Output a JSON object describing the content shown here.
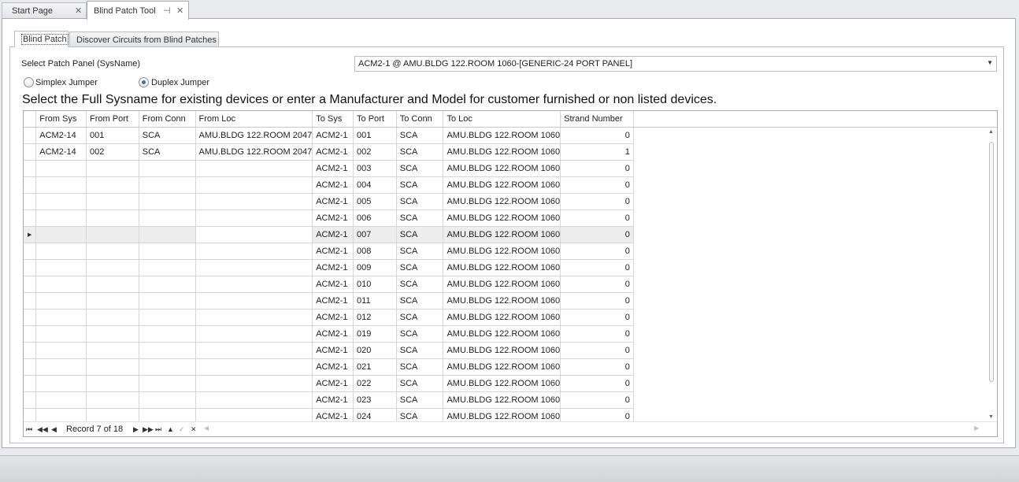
{
  "doc_tabs": [
    {
      "label": "Start Page",
      "close": "✕"
    },
    {
      "label": "Blind Patch Tool",
      "pin": "⊣",
      "close": "✕"
    }
  ],
  "inner_tabs": [
    "Blind Patch",
    "Discover Circuits from Blind Patches"
  ],
  "form": {
    "patch_panel_label": "Select Patch Panel (SysName)",
    "patch_panel_value": "ACM2-1 @ AMU.BLDG 122.ROOM 1060-[GENERIC-24 PORT PANEL]",
    "radio_simplex": "Simplex Jumper",
    "radio_duplex": "Duplex Jumper",
    "selected_jumper": "Duplex Jumper",
    "instruction": "Select the Full Sysname for existing devices or enter a Manufacturer and Model for customer furnished or non listed devices."
  },
  "grid": {
    "columns": [
      "From Sys",
      "From Port",
      "From Conn",
      "From Loc",
      "To Sys",
      "To Port",
      "To Conn",
      "To Loc",
      "Strand Number"
    ],
    "focused_row": 7,
    "rows": [
      [
        "ACM2-14",
        "001",
        "SCA",
        "AMU.BLDG 122.ROOM 2047",
        "ACM2-1",
        "001",
        "SCA",
        "AMU.BLDG 122.ROOM 1060",
        "0"
      ],
      [
        "ACM2-14",
        "002",
        "SCA",
        "AMU.BLDG 122.ROOM 2047",
        "ACM2-1",
        "002",
        "SCA",
        "AMU.BLDG 122.ROOM 1060",
        "1"
      ],
      [
        "",
        "",
        "",
        "",
        "ACM2-1",
        "003",
        "SCA",
        "AMU.BLDG 122.ROOM 1060",
        "0"
      ],
      [
        "",
        "",
        "",
        "",
        "ACM2-1",
        "004",
        "SCA",
        "AMU.BLDG 122.ROOM 1060",
        "0"
      ],
      [
        "",
        "",
        "",
        "",
        "ACM2-1",
        "005",
        "SCA",
        "AMU.BLDG 122.ROOM 1060",
        "0"
      ],
      [
        "",
        "",
        "",
        "",
        "ACM2-1",
        "006",
        "SCA",
        "AMU.BLDG 122.ROOM 1060",
        "0"
      ],
      [
        "",
        "",
        "",
        "",
        "ACM2-1",
        "007",
        "SCA",
        "AMU.BLDG 122.ROOM 1060",
        "0"
      ],
      [
        "",
        "",
        "",
        "",
        "ACM2-1",
        "008",
        "SCA",
        "AMU.BLDG 122.ROOM 1060",
        "0"
      ],
      [
        "",
        "",
        "",
        "",
        "ACM2-1",
        "009",
        "SCA",
        "AMU.BLDG 122.ROOM 1060",
        "0"
      ],
      [
        "",
        "",
        "",
        "",
        "ACM2-1",
        "010",
        "SCA",
        "AMU.BLDG 122.ROOM 1060",
        "0"
      ],
      [
        "",
        "",
        "",
        "",
        "ACM2-1",
        "011",
        "SCA",
        "AMU.BLDG 122.ROOM 1060",
        "0"
      ],
      [
        "",
        "",
        "",
        "",
        "ACM2-1",
        "012",
        "SCA",
        "AMU.BLDG 122.ROOM 1060",
        "0"
      ],
      [
        "",
        "",
        "",
        "",
        "ACM2-1",
        "019",
        "SCA",
        "AMU.BLDG 122.ROOM 1060",
        "0"
      ],
      [
        "",
        "",
        "",
        "",
        "ACM2-1",
        "020",
        "SCA",
        "AMU.BLDG 122.ROOM 1060",
        "0"
      ],
      [
        "",
        "",
        "",
        "",
        "ACM2-1",
        "021",
        "SCA",
        "AMU.BLDG 122.ROOM 1060",
        "0"
      ],
      [
        "",
        "",
        "",
        "",
        "ACM2-1",
        "022",
        "SCA",
        "AMU.BLDG 122.ROOM 1060",
        "0"
      ],
      [
        "",
        "",
        "",
        "",
        "ACM2-1",
        "023",
        "SCA",
        "AMU.BLDG 122.ROOM 1060",
        "0"
      ],
      [
        "",
        "",
        "",
        "",
        "ACM2-1",
        "024",
        "SCA",
        "AMU.BLDG 122.ROOM 1060",
        "0"
      ]
    ]
  },
  "navigator": {
    "record_text": "Record 7 of 18",
    "first": "⏮",
    "prev_page": "◀◀",
    "prev": "◀",
    "next": "▶",
    "next_page": "▶▶",
    "last": "⏭",
    "append": "▲",
    "end_edit": "✓",
    "cancel_edit": "✕"
  },
  "icons": {
    "row_indicator": "▶",
    "dropdown": "▼",
    "scroll_up": "▲",
    "scroll_down": "▼",
    "scroll_left": "◀",
    "scroll_right": "▶"
  }
}
